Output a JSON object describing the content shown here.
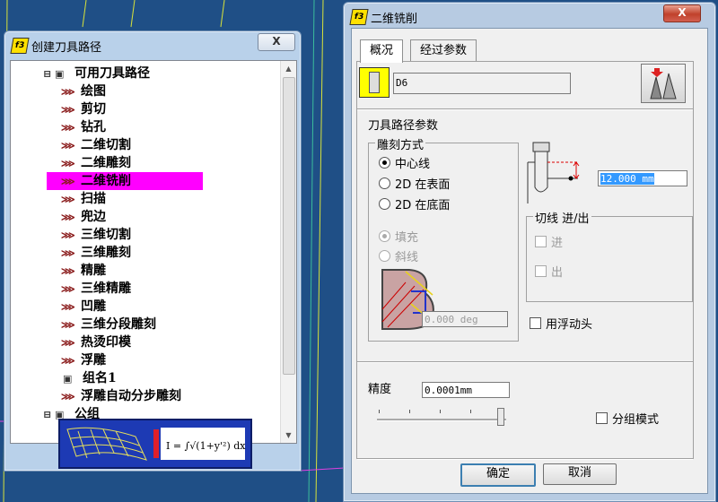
{
  "tree_window": {
    "title": "创建刀具路径",
    "close_label": "X",
    "items": [
      {
        "label": "可用刀具路径",
        "icon": "folder-icon"
      },
      {
        "label": "绘图",
        "icon": "toolpath-icon"
      },
      {
        "label": "剪切",
        "icon": "toolpath-icon"
      },
      {
        "label": "钻孔",
        "icon": "toolpath-icon"
      },
      {
        "label": "二维切割",
        "icon": "toolpath-icon"
      },
      {
        "label": "二维雕刻",
        "icon": "toolpath-icon"
      },
      {
        "label": "二维铣削",
        "icon": "toolpath-icon",
        "selected": true
      },
      {
        "label": "扫描",
        "icon": "toolpath-icon"
      },
      {
        "label": "兜边",
        "icon": "toolpath-icon"
      },
      {
        "label": "三维切割",
        "icon": "toolpath-icon"
      },
      {
        "label": "三维雕刻",
        "icon": "toolpath-icon"
      },
      {
        "label": "精雕",
        "icon": "toolpath-icon"
      },
      {
        "label": "三维精雕",
        "icon": "toolpath-icon"
      },
      {
        "label": "凹雕",
        "icon": "toolpath-icon"
      },
      {
        "label": "三维分段雕刻",
        "icon": "toolpath-icon"
      },
      {
        "label": "热烫印模",
        "icon": "toolpath-icon"
      },
      {
        "label": "浮雕",
        "icon": "toolpath-icon"
      },
      {
        "label": "组名1",
        "icon": "folder-icon"
      },
      {
        "label": "浮雕自动分步雕刻",
        "icon": "toolpath-icon"
      },
      {
        "label": "公组",
        "icon": "folder-icon"
      }
    ],
    "selected_color": "#ff00ff"
  },
  "dialog": {
    "title": "二维铣削",
    "close_label": "X",
    "tabs": [
      "概况",
      "经过参数"
    ],
    "tool_name": "D6",
    "section_title": "刀具路径参数",
    "engrave_group": "雕刻方式",
    "engrave_options": [
      "中心线",
      "2D 在表面",
      "2D 在底面"
    ],
    "fill_options": [
      "填充",
      "斜线"
    ],
    "angle_value": "0.000 deg",
    "depth_value": "12.000 mm",
    "lead_group": "切线 进/出",
    "lead_in": "进",
    "lead_out": "出",
    "floating_head": "用浮动头",
    "precision_label": "精度",
    "precision_value": "0.0001mm",
    "group_mode": "分组模式",
    "ok_label": "确定",
    "cancel_label": "取消"
  }
}
